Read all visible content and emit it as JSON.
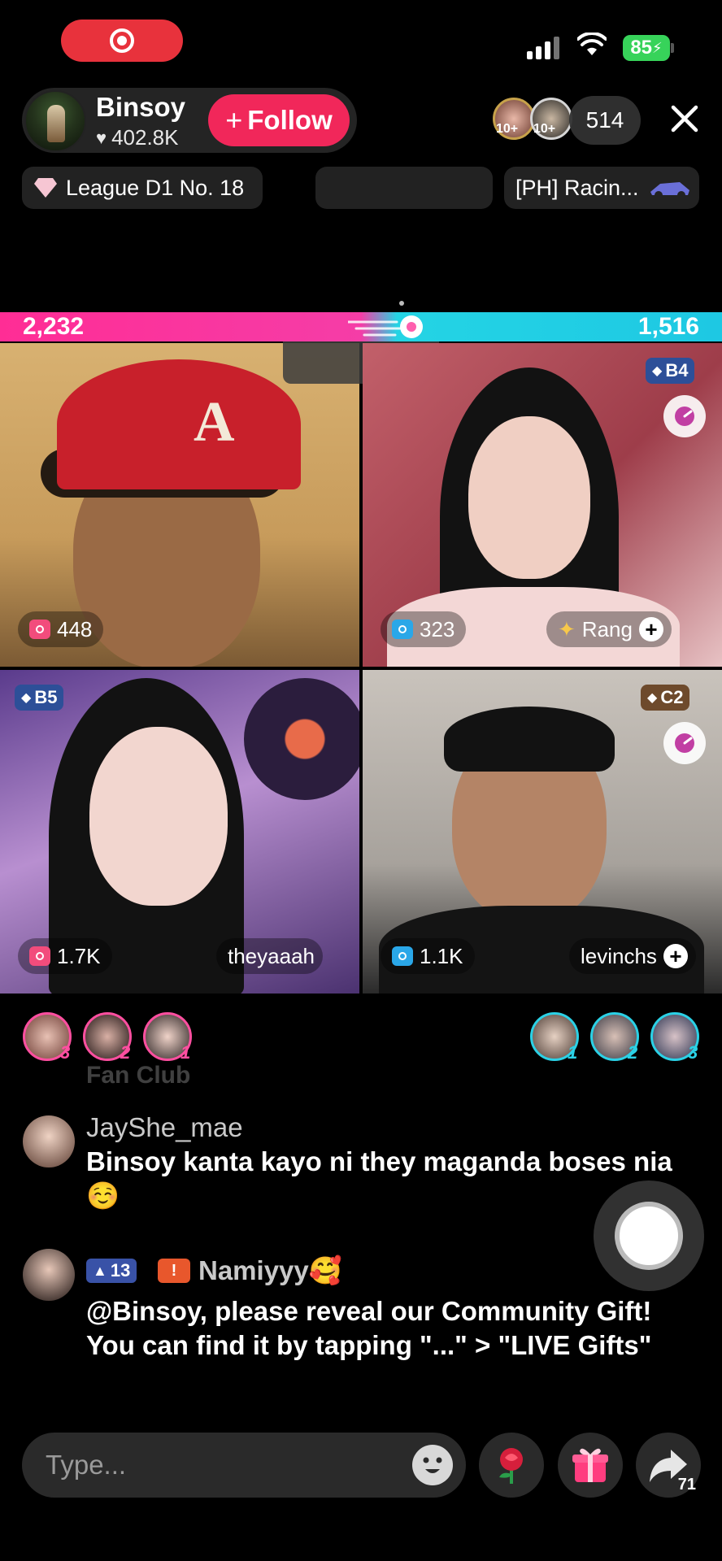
{
  "status": {
    "battery": "85"
  },
  "host": {
    "name": "Binsoy",
    "likes": "402.8K",
    "follow_label": "Follow"
  },
  "viewers": {
    "badge_1": "10+",
    "badge_2": "10+",
    "count": "514"
  },
  "chips": {
    "league": "League D1 No. 18",
    "event": "[PH] Racin..."
  },
  "battle": {
    "left_score": "2,232",
    "right_score": "1,516"
  },
  "tiles": [
    {
      "gifts": "448"
    },
    {
      "gifts": "323",
      "rank": "B4",
      "name": "Rang"
    },
    {
      "gifts": "1.7K",
      "rank": "B5",
      "name": "theyaaah"
    },
    {
      "gifts": "1.1K",
      "rank": "C2",
      "name": "levinchs"
    }
  ],
  "supporters": {
    "left": [
      "3",
      "2",
      "1"
    ],
    "right": [
      "1",
      "2",
      "3"
    ]
  },
  "chat": {
    "faded_text": "Fan Club",
    "messages": [
      {
        "user": "JayShe_mae",
        "text": "Binsoy kanta kayo ni they maganda boses nia ☺️"
      },
      {
        "user": "Namiyyy🥰",
        "level": "13",
        "text": "@Binsoy, please reveal our Community Gift! You can find it by tapping \"...\" > \"LIVE Gifts\""
      }
    ]
  },
  "composer": {
    "placeholder": "Type...",
    "share_count": "71"
  },
  "colors": {
    "accent_pink": "#f1275a",
    "team_pink": "#ff2d95",
    "team_cyan": "#1ec8e3"
  }
}
